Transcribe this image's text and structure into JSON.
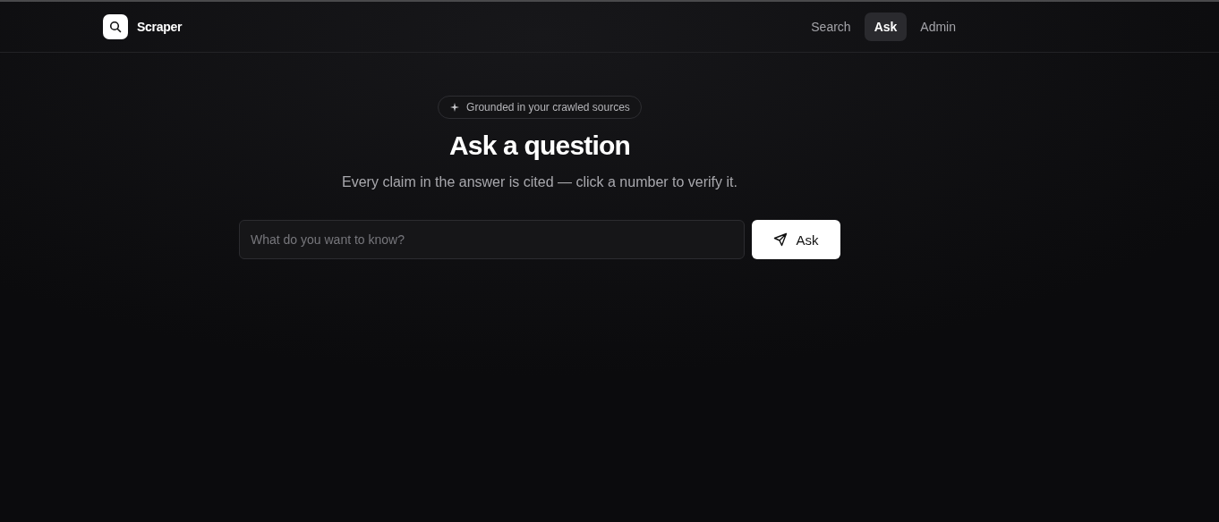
{
  "brand": {
    "name": "Scraper"
  },
  "nav": [
    {
      "label": "Search",
      "selected": false
    },
    {
      "label": "Ask",
      "selected": true
    },
    {
      "label": "Admin",
      "selected": false
    }
  ],
  "badge": "Grounded in your crawled sources",
  "title": "Ask a question",
  "subtitle": "Every claim in the answer is cited — click a number to verify it.",
  "query": {
    "placeholder": "What do you want to know?"
  },
  "submit": {
    "label": "Ask"
  }
}
